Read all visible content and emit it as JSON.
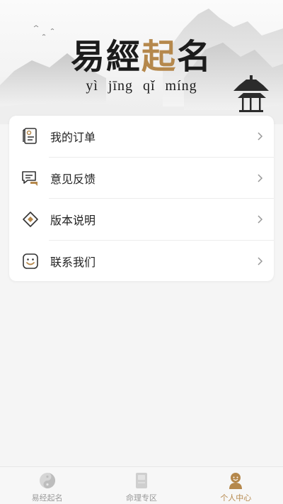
{
  "header": {
    "title_chars": [
      "易",
      "經",
      "起",
      "名"
    ],
    "pinyin": "yì jīng qǐ míng",
    "accent_color": "#b5884c"
  },
  "menu": {
    "items": [
      {
        "label": "我的订单",
        "icon": "order-scroll-icon"
      },
      {
        "label": "意见反馈",
        "icon": "feedback-chat-icon"
      },
      {
        "label": "版本说明",
        "icon": "version-diamond-icon"
      },
      {
        "label": "联系我们",
        "icon": "contact-face-icon"
      }
    ]
  },
  "tabbar": {
    "tabs": [
      {
        "label": "易经起名",
        "icon": "yin-yang-icon",
        "active": false
      },
      {
        "label": "命理专区",
        "icon": "book-icon",
        "active": false
      },
      {
        "label": "个人中心",
        "icon": "person-icon",
        "active": true
      }
    ],
    "active_color": "#b5884c",
    "inactive_color": "#999999"
  }
}
